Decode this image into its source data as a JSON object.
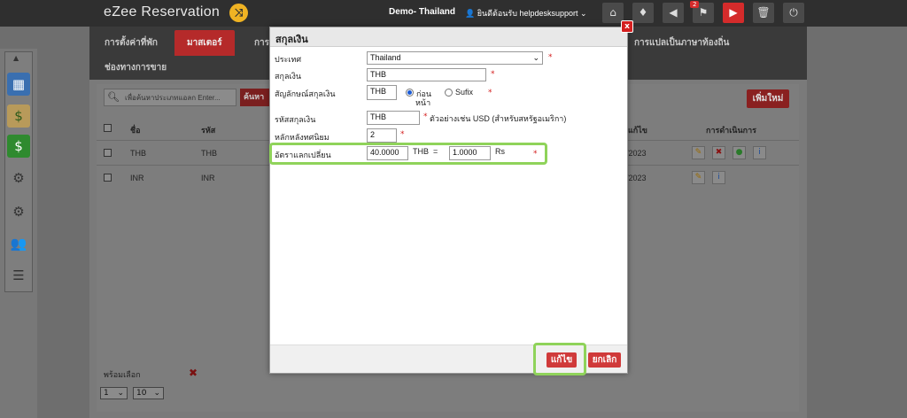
{
  "header": {
    "brand": "eZee Reservation",
    "hotel": "Demo- Thailand",
    "user": "ยินดีต้อนรับ helpdesksupport",
    "notification_count": "2"
  },
  "nav": {
    "items": [
      "การตั้งค่าที่พัก",
      "มาสเตอร์",
      "การ",
      "การแปลเป็นภาษาท้องถิ่น",
      "ช่องทางการขาย"
    ]
  },
  "list": {
    "search_placeholder": "เพื่อค้นหาประเภทแอลก Enter...",
    "search_button": "ค้นหา",
    "add_button": "เพิ่มใหม่",
    "columns": [
      "ชื่อ",
      "รหัส",
      "แก้ไข",
      "การดำเนินการ"
    ],
    "rows": [
      {
        "name": "THB",
        "code": "THB",
        "date": "/2023"
      },
      {
        "name": "INR",
        "code": "INR",
        "date": "/2023"
      }
    ],
    "bulk_label": "พร้อมเลือก",
    "page": "1",
    "page_size": "10"
  },
  "modal": {
    "title": "สกุลเงิน",
    "close": "x",
    "country_label": "ประเทศ",
    "country_value": "Thailand",
    "currency_label": "สกุลเงิน",
    "currency_value": "THB",
    "symbol_label": "สัญลักษณ์สกุลเงิน",
    "symbol_value": "THB",
    "prefix_label_1": "ก่อน",
    "prefix_label_2": "หน้า",
    "suffix_label": "Sufix",
    "code_label": "รหัสสกุลเงิน",
    "code_value": "THB",
    "code_hint": "ตัวอย่างเช่น USD (สำหรับสหรัฐอเมริกา)",
    "decimal_label": "หลักหลังทศนิยม",
    "decimal_value": "2",
    "rate_label": "อัตราแลกเปลี่ยน",
    "rate_from": "40.0000",
    "rate_from_unit": "THB",
    "rate_eq": "=",
    "rate_to": "1.0000",
    "rate_to_unit": "Rs",
    "required_mark": "*",
    "save_button": "แก้ไข",
    "cancel_button": "ยกเลิก"
  }
}
